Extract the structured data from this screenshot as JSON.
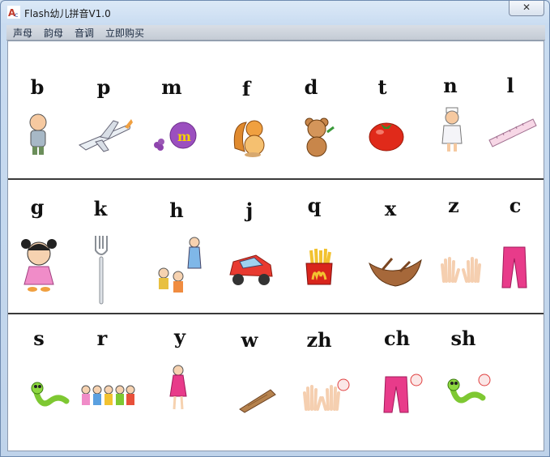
{
  "window": {
    "title": "Flash幼儿拼音V1.0",
    "close_label": "✕"
  },
  "menu": [
    "声母",
    "韵母",
    "音调",
    "立即购买"
  ],
  "rows": [
    {
      "letters": [
        "b",
        "p",
        "m",
        "f",
        "d",
        "t",
        "n",
        "l"
      ],
      "pictures": [
        "boy-figure",
        "airplane",
        "grapes",
        "squirrel",
        "bear",
        "tomato",
        "nurse",
        "ruler"
      ]
    },
    {
      "letters": [
        "g",
        "k",
        "h",
        "j",
        "q",
        "x",
        "z",
        "c"
      ],
      "pictures": [
        "girl",
        "fork",
        "drinking-children",
        "toy-car",
        "french-fries",
        "boat",
        "hands",
        "pants"
      ]
    },
    {
      "letters": [
        "s",
        "r",
        "y",
        "w",
        "zh",
        "ch",
        "sh"
      ],
      "pictures": [
        "snake",
        "kids-group",
        "girl-in-dress",
        "wooden-stick",
        "hands-with-ball",
        "pants-with-ball",
        "snake-with-ball"
      ]
    }
  ],
  "colors": {
    "accent": "#e83b8a",
    "frame": "#c9dcf1"
  }
}
